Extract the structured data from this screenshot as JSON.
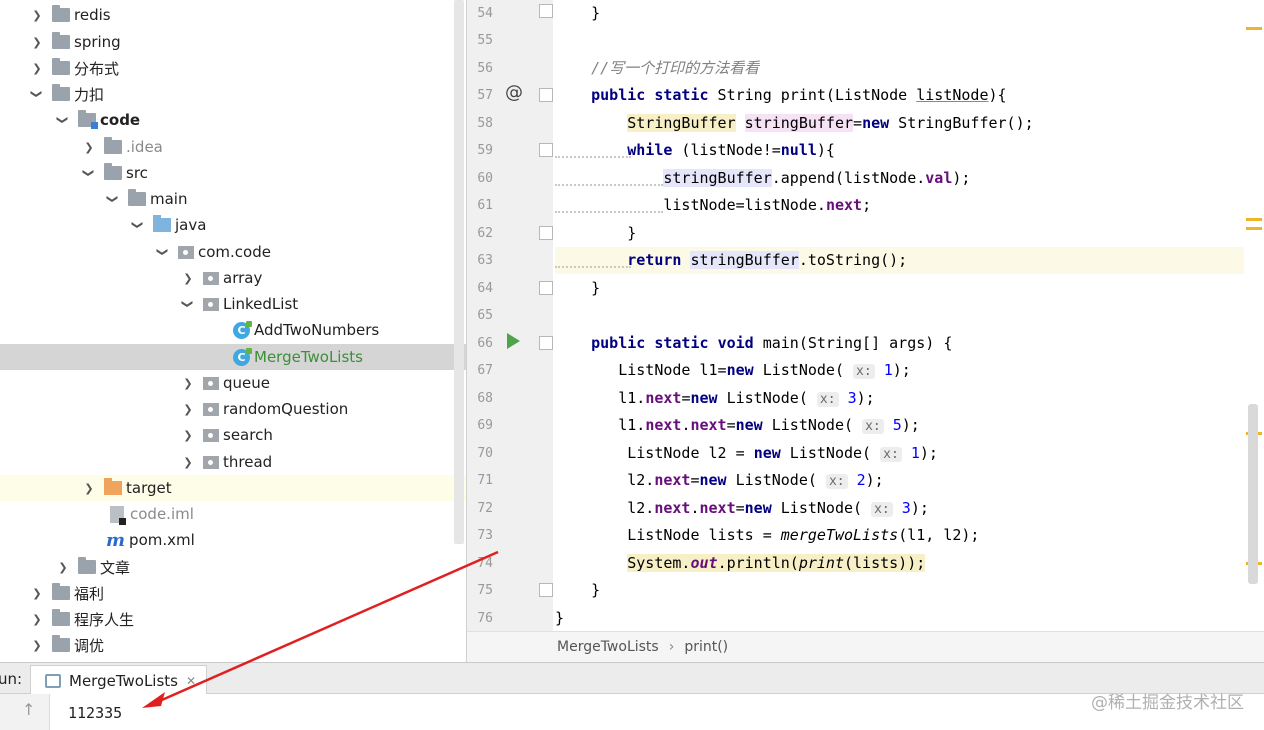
{
  "tree": {
    "items": [
      {
        "label": "redis"
      },
      {
        "label": "spring"
      },
      {
        "label": "分布式"
      },
      {
        "label": "力扣"
      },
      {
        "label": "code"
      },
      {
        "label": ".idea"
      },
      {
        "label": "src"
      },
      {
        "label": "main"
      },
      {
        "label": "java"
      },
      {
        "label": "com.code"
      },
      {
        "label": "array"
      },
      {
        "label": "LinkedList"
      },
      {
        "label": "AddTwoNumbers"
      },
      {
        "label": "MergeTwoLists"
      },
      {
        "label": "queue"
      },
      {
        "label": "randomQuestion"
      },
      {
        "label": "search"
      },
      {
        "label": "thread"
      },
      {
        "label": "target"
      },
      {
        "label": "code.iml"
      },
      {
        "label": "pom.xml"
      },
      {
        "label": "文章"
      },
      {
        "label": "福利"
      },
      {
        "label": "程序人生"
      },
      {
        "label": "调优"
      }
    ]
  },
  "editor": {
    "line_numbers": [
      "54",
      "55",
      "56",
      "57",
      "58",
      "59",
      "60",
      "61",
      "62",
      "63",
      "64",
      "65",
      "66",
      "67",
      "68",
      "69",
      "70",
      "71",
      "72",
      "73",
      "74",
      "75",
      "76"
    ],
    "comment_56": "//写一个打印的方法看看",
    "breadcrumb": {
      "file": "MergeTwoLists",
      "method": "print()"
    }
  },
  "run": {
    "prefix": "un:",
    "tab_label": "MergeTwoLists",
    "output": "112335",
    "watermark": "@稀土掘金技术社区"
  }
}
